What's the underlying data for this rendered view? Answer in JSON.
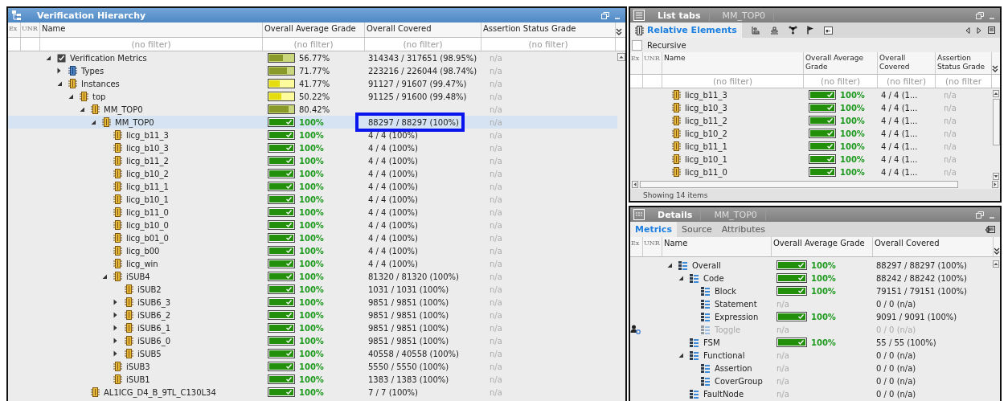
{
  "hierarchy": {
    "title": "Verification Hierarchy",
    "columns": [
      "Ex",
      "UNR",
      "Name",
      "Overall Average Grade",
      "Overall Covered",
      "Assertion Status Grade"
    ],
    "filters": [
      "(no filter)",
      "(no filter)",
      "(no filter)",
      "(no filter)"
    ],
    "tree": [
      {
        "name": "Verification Metrics",
        "kind": "metrics",
        "expanded": true,
        "selected": false,
        "grade": {
          "level": 0.5677,
          "reading": "56.77%"
        },
        "covered": "314343 / 317651 (98.95%)",
        "assertion": "n/a",
        "children": [
          {
            "name": "Types",
            "kind": "type",
            "expanded": false,
            "selected": false,
            "grade": {
              "level": 0.7177,
              "reading": "71.77%"
            },
            "covered": "223216 / 226044 (98.74%)",
            "assertion": "n/a"
          },
          {
            "name": "Instances",
            "expanded": true,
            "selected": false,
            "grade": {
              "level": 0.4177,
              "reading": "41.77%"
            },
            "covered": "91127 / 91607 (99.47%)",
            "assertion": "n/a",
            "children": [
              {
                "name": "top",
                "expanded": true,
                "selected": false,
                "grade": {
                  "level": 0.5022,
                  "reading": "50.22%"
                },
                "covered": "91125 / 91600 (99.48%)",
                "assertion": "n/a",
                "children": [
                  {
                    "name": "MM_TOP0",
                    "expanded": true,
                    "selected": false,
                    "grade": {
                      "level": 0.8042,
                      "reading": "80.42%"
                    },
                    "assertion": "n/a",
                    "children": [
                      {
                        "name": "MM_TOP0",
                        "expanded": true,
                        "selected": true,
                        "highlight": true,
                        "grade": {
                          "level": 1,
                          "reading": "100%"
                        },
                        "covered": "88297 / 88297 (100%)",
                        "assertion": "n/a",
                        "children": [
                          {
                            "name": "licg_b11_3",
                            "selected": false,
                            "grade": {
                              "level": 1,
                              "reading": "100%"
                            },
                            "covered": "4 / 4 (100%)",
                            "assertion": "n/a"
                          },
                          {
                            "name": "licg_b10_3",
                            "selected": false,
                            "grade": {
                              "level": 1,
                              "reading": "100%"
                            },
                            "covered": "4 / 4 (100%)",
                            "assertion": "n/a"
                          },
                          {
                            "name": "licg_b11_2",
                            "selected": false,
                            "grade": {
                              "level": 1,
                              "reading": "100%"
                            },
                            "covered": "4 / 4 (100%)",
                            "assertion": "n/a"
                          },
                          {
                            "name": "licg_b10_2",
                            "selected": false,
                            "grade": {
                              "level": 1,
                              "reading": "100%"
                            },
                            "covered": "4 / 4 (100%)",
                            "assertion": "n/a"
                          },
                          {
                            "name": "licg_b11_1",
                            "selected": false,
                            "grade": {
                              "level": 1,
                              "reading": "100%"
                            },
                            "covered": "4 / 4 (100%)",
                            "assertion": "n/a"
                          },
                          {
                            "name": "licg_b10_1",
                            "selected": false,
                            "grade": {
                              "level": 1,
                              "reading": "100%"
                            },
                            "covered": "4 / 4 (100%)",
                            "assertion": "n/a"
                          },
                          {
                            "name": "licg_b11_0",
                            "selected": false,
                            "grade": {
                              "level": 1,
                              "reading": "100%"
                            },
                            "covered": "4 / 4 (100%)",
                            "assertion": "n/a"
                          },
                          {
                            "name": "licg_b10_0",
                            "selected": false,
                            "grade": {
                              "level": 1,
                              "reading": "100%"
                            },
                            "covered": "4 / 4 (100%)",
                            "assertion": "n/a"
                          },
                          {
                            "name": "licg_b01_0",
                            "selected": false,
                            "grade": {
                              "level": 1,
                              "reading": "100%"
                            },
                            "covered": "4 / 4 (100%)",
                            "assertion": "n/a"
                          },
                          {
                            "name": "licg_b00",
                            "selected": false,
                            "grade": {
                              "level": 1,
                              "reading": "100%"
                            },
                            "covered": "4 / 4 (100%)",
                            "assertion": "n/a"
                          },
                          {
                            "name": "licg_win",
                            "selected": false,
                            "grade": {
                              "level": 1,
                              "reading": "100%"
                            },
                            "covered": "4 / 4 (100%)",
                            "assertion": "n/a"
                          },
                          {
                            "name": "iSUB4",
                            "expanded": true,
                            "selected": false,
                            "grade": {
                              "level": 1,
                              "reading": "100%"
                            },
                            "covered": "81320 / 81320 (100%)",
                            "assertion": "n/a",
                            "children": [
                              {
                                "name": "iSUB2",
                                "selected": false,
                                "grade": {
                                  "level": 1,
                                  "reading": "100%"
                                },
                                "covered": "1031 / 1031 (100%)",
                                "assertion": "n/a"
                              },
                              {
                                "name": "iSUB6_3",
                                "expanded": false,
                                "selected": false,
                                "grade": {
                                  "level": 1,
                                  "reading": "100%"
                                },
                                "covered": "9851 / 9851 (100%)",
                                "assertion": "n/a"
                              },
                              {
                                "name": "iSUB6_2",
                                "expanded": false,
                                "selected": false,
                                "grade": {
                                  "level": 1,
                                  "reading": "100%"
                                },
                                "covered": "9851 / 9851 (100%)",
                                "assertion": "n/a"
                              },
                              {
                                "name": "iSUB6_1",
                                "expanded": false,
                                "selected": false,
                                "grade": {
                                  "level": 1,
                                  "reading": "100%"
                                },
                                "covered": "9851 / 9851 (100%)",
                                "assertion": "n/a"
                              },
                              {
                                "name": "iSUB6_0",
                                "expanded": false,
                                "selected": false,
                                "grade": {
                                  "level": 1,
                                  "reading": "100%"
                                },
                                "covered": "9851 / 9851 (100%)",
                                "assertion": "n/a"
                              },
                              {
                                "name": "iSUB5",
                                "expanded": false,
                                "selected": false,
                                "grade": {
                                  "level": 1,
                                  "reading": "100%"
                                },
                                "covered": "40558 / 40558 (100%)",
                                "assertion": "n/a"
                              }
                            ]
                          },
                          {
                            "name": "iSUB3",
                            "selected": false,
                            "grade": {
                              "level": 1,
                              "reading": "100%"
                            },
                            "covered": "5550 / 5550 (100%)",
                            "assertion": "n/a"
                          },
                          {
                            "name": "iSUB1",
                            "selected": false,
                            "grade": {
                              "level": 1,
                              "reading": "100%"
                            },
                            "covered": "1383 / 1383 (100%)",
                            "assertion": "n/a"
                          }
                        ]
                      }
                    ]
                  },
                  {
                    "name": "AL1ICG_D4_B_9TL_C130L34",
                    "selected": false,
                    "grade": {
                      "level": 1,
                      "reading": "100%"
                    },
                    "covered": "7 / 7 (100%)",
                    "assertion": "n/a"
                  }
                ]
              }
            ]
          }
        ]
      }
    ]
  },
  "list_panel": {
    "tabs": [
      {
        "label": "List tabs",
        "selected": true
      },
      {
        "label": "MM_TOP0",
        "selected": false
      }
    ],
    "subtab": {
      "label": "Relative Elements",
      "selected": true
    },
    "recursive": {
      "label": "Recursive",
      "checked": false
    },
    "columns": [
      "Ex",
      "UNR",
      "Name",
      "Overall Average Grade",
      "Overall Covered",
      "Assertion Status Grade"
    ],
    "filters": [
      "(no filter)",
      "(no filter)",
      "(no filter)",
      "(no filter"
    ],
    "rows": [
      {
        "name": "licg_b11_3",
        "grade": {
          "level": 1,
          "reading": "100%"
        },
        "covered": "4 / 4 (1...",
        "assertion": "n/a"
      },
      {
        "name": "licg_b10_3",
        "grade": {
          "level": 1,
          "reading": "100%"
        },
        "covered": "4 / 4 (1...",
        "assertion": "n/a"
      },
      {
        "name": "licg_b11_2",
        "grade": {
          "level": 1,
          "reading": "100%"
        },
        "covered": "4 / 4 (1...",
        "assertion": "n/a"
      },
      {
        "name": "licg_b10_2",
        "grade": {
          "level": 1,
          "reading": "100%"
        },
        "covered": "4 / 4 (1...",
        "assertion": "n/a"
      },
      {
        "name": "licg_b11_1",
        "grade": {
          "level": 1,
          "reading": "100%"
        },
        "covered": "4 / 4 (1...",
        "assertion": "n/a"
      },
      {
        "name": "licg_b10_1",
        "grade": {
          "level": 1,
          "reading": "100%"
        },
        "covered": "4 / 4 (1...",
        "assertion": "n/a"
      },
      {
        "name": "licg_b11_0",
        "grade": {
          "level": 1,
          "reading": "100%"
        },
        "covered": "4 / 4 (1...",
        "assertion": "n/a"
      }
    ],
    "status": "Showing 14 items"
  },
  "details_panel": {
    "tabs": [
      {
        "label": "Details",
        "selected": true
      },
      {
        "label": "MM_TOP0",
        "selected": false
      }
    ],
    "subtabs": [
      {
        "label": "Metrics",
        "selected": true
      },
      {
        "label": "Source",
        "selected": false
      },
      {
        "label": "Attributes",
        "selected": false
      }
    ],
    "columns": [
      "Ex",
      "UNR",
      "Name",
      "Overall Average Grade",
      "Overall Covered"
    ],
    "tree": [
      {
        "name": "Overall",
        "expanded": true,
        "excluded": false,
        "grade": {
          "level": 1,
          "reading": "100%"
        },
        "covered": "88297 / 88297 (100%)",
        "children": [
          {
            "name": "Code",
            "expanded": true,
            "excluded": false,
            "grade": {
              "level": 1,
              "reading": "100%"
            },
            "covered": "88242 / 88242 (100%)",
            "children": [
              {
                "name": "Block",
                "excluded": false,
                "grade": {
                  "level": 1,
                  "reading": "100%"
                },
                "covered": "79151 / 79151 (100%)"
              },
              {
                "name": "Statement",
                "excluded": false,
                "grade": {
                  "reading": "n/a"
                },
                "covered": "0 / 0 (n/a)"
              },
              {
                "name": "Expression",
                "excluded": false,
                "grade": {
                  "level": 1,
                  "reading": "100%"
                },
                "covered": "9091 / 9091 (100%)"
              },
              {
                "name": "Toggle",
                "excluded": true,
                "grade": {
                  "reading": "n/a"
                },
                "covered": "0 / 0 (n/a)"
              }
            ]
          },
          {
            "name": "FSM",
            "excluded": false,
            "grade": {
              "level": 1,
              "reading": "100%"
            },
            "covered": "55 / 55 (100%)"
          },
          {
            "name": "Functional",
            "expanded": true,
            "excluded": false,
            "grade": {
              "reading": "n/a"
            },
            "covered": "0 / 0 (n/a)",
            "children": [
              {
                "name": "Assertion",
                "excluded": false,
                "grade": {
                  "reading": "n/a"
                },
                "covered": "0 / 0 (n/a)"
              },
              {
                "name": "CoverGroup",
                "excluded": false,
                "grade": {
                  "reading": "n/a"
                },
                "covered": "0 / 0 (n/a)"
              }
            ]
          },
          {
            "name": "FaultNode",
            "excluded": false,
            "grade": {
              "reading": "n/a"
            },
            "covered": "0 / 0 (n/a)"
          }
        ]
      }
    ]
  }
}
